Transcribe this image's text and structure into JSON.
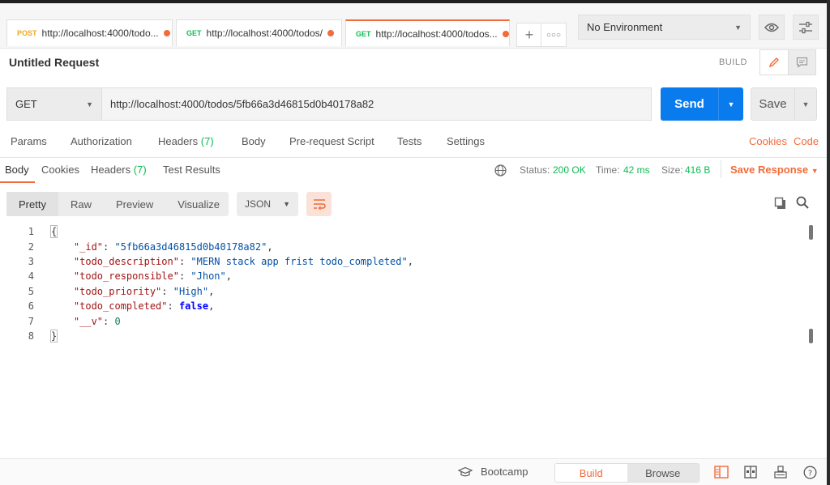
{
  "tabs": [
    {
      "method": "POST",
      "url": "http://localhost:4000/todo...",
      "unsaved": true
    },
    {
      "method": "GET",
      "url": "http://localhost:4000/todos/",
      "unsaved": true
    },
    {
      "method": "GET",
      "url": "http://localhost:4000/todos...",
      "unsaved": true,
      "active": true
    }
  ],
  "environment": {
    "selected": "No Environment"
  },
  "request": {
    "title": "Untitled Request",
    "mode_label": "BUILD",
    "method": "GET",
    "url": "http://localhost:4000/todos/5fb66a3d46815d0b40178a82",
    "send_label": "Send",
    "save_label": "Save"
  },
  "request_tabs": {
    "params": "Params",
    "authorization": "Authorization",
    "headers": "Headers",
    "headers_count": "(7)",
    "body": "Body",
    "prerequest": "Pre-request Script",
    "tests": "Tests",
    "settings": "Settings",
    "cookies": "Cookies",
    "code": "Code"
  },
  "response_tabs": {
    "body": "Body",
    "cookies": "Cookies",
    "headers": "Headers",
    "headers_count": "(7)",
    "test_results": "Test Results"
  },
  "response_status": {
    "status_label": "Status:",
    "status_value": "200 OK",
    "time_label": "Time:",
    "time_value": "42 ms",
    "size_label": "Size:",
    "size_value": "416 B",
    "save_response": "Save Response"
  },
  "format_bar": {
    "pretty": "Pretty",
    "raw": "Raw",
    "preview": "Preview",
    "visualize": "Visualize",
    "language": "JSON"
  },
  "body_lines": [
    {
      "num": "1",
      "text": "{"
    },
    {
      "num": "2",
      "key": "\"_id\"",
      "value": "\"5fb66a3d46815d0b40178a82\"",
      "type": "string"
    },
    {
      "num": "3",
      "key": "\"todo_description\"",
      "value": "\"MERN stack app frist todo_completed\"",
      "type": "string"
    },
    {
      "num": "4",
      "key": "\"todo_responsible\"",
      "value": "\"Jhon\"",
      "type": "string"
    },
    {
      "num": "5",
      "key": "\"todo_priority\"",
      "value": "\"High\"",
      "type": "string"
    },
    {
      "num": "6",
      "key": "\"todo_completed\"",
      "value": "false",
      "type": "bool"
    },
    {
      "num": "7",
      "key": "\"__v\"",
      "value": "0",
      "type": "number"
    },
    {
      "num": "8",
      "text": "}"
    }
  ],
  "footer": {
    "bootcamp": "Bootcamp",
    "build": "Build",
    "browse": "Browse"
  }
}
